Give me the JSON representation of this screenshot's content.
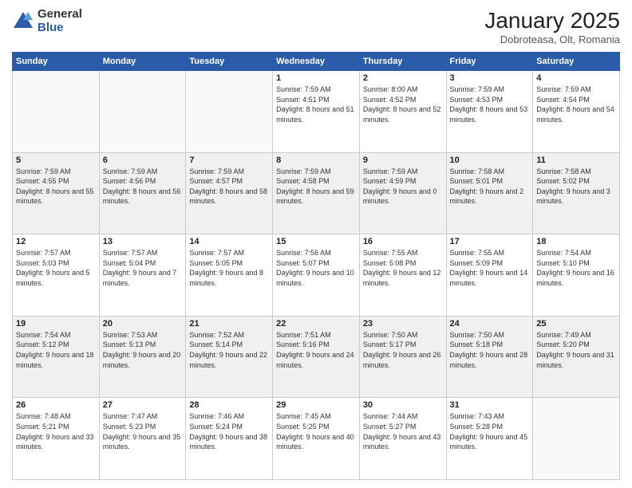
{
  "logo": {
    "general": "General",
    "blue": "Blue"
  },
  "header": {
    "month": "January 2025",
    "location": "Dobroteasa, Olt, Romania"
  },
  "weekdays": [
    "Sunday",
    "Monday",
    "Tuesday",
    "Wednesday",
    "Thursday",
    "Friday",
    "Saturday"
  ],
  "weeks": [
    [
      {
        "day": "",
        "info": ""
      },
      {
        "day": "",
        "info": ""
      },
      {
        "day": "",
        "info": ""
      },
      {
        "day": "1",
        "info": "Sunrise: 7:59 AM\nSunset: 4:51 PM\nDaylight: 8 hours and 51 minutes."
      },
      {
        "day": "2",
        "info": "Sunrise: 8:00 AM\nSunset: 4:52 PM\nDaylight: 8 hours and 52 minutes."
      },
      {
        "day": "3",
        "info": "Sunrise: 7:59 AM\nSunset: 4:53 PM\nDaylight: 8 hours and 53 minutes."
      },
      {
        "day": "4",
        "info": "Sunrise: 7:59 AM\nSunset: 4:54 PM\nDaylight: 8 hours and 54 minutes."
      }
    ],
    [
      {
        "day": "5",
        "info": "Sunrise: 7:59 AM\nSunset: 4:55 PM\nDaylight: 8 hours and 55 minutes."
      },
      {
        "day": "6",
        "info": "Sunrise: 7:59 AM\nSunset: 4:56 PM\nDaylight: 8 hours and 56 minutes."
      },
      {
        "day": "7",
        "info": "Sunrise: 7:59 AM\nSunset: 4:57 PM\nDaylight: 8 hours and 58 minutes."
      },
      {
        "day": "8",
        "info": "Sunrise: 7:59 AM\nSunset: 4:58 PM\nDaylight: 8 hours and 59 minutes."
      },
      {
        "day": "9",
        "info": "Sunrise: 7:59 AM\nSunset: 4:59 PM\nDaylight: 9 hours and 0 minutes."
      },
      {
        "day": "10",
        "info": "Sunrise: 7:58 AM\nSunset: 5:01 PM\nDaylight: 9 hours and 2 minutes."
      },
      {
        "day": "11",
        "info": "Sunrise: 7:58 AM\nSunset: 5:02 PM\nDaylight: 9 hours and 3 minutes."
      }
    ],
    [
      {
        "day": "12",
        "info": "Sunrise: 7:57 AM\nSunset: 5:03 PM\nDaylight: 9 hours and 5 minutes."
      },
      {
        "day": "13",
        "info": "Sunrise: 7:57 AM\nSunset: 5:04 PM\nDaylight: 9 hours and 7 minutes."
      },
      {
        "day": "14",
        "info": "Sunrise: 7:57 AM\nSunset: 5:05 PM\nDaylight: 9 hours and 8 minutes."
      },
      {
        "day": "15",
        "info": "Sunrise: 7:56 AM\nSunset: 5:07 PM\nDaylight: 9 hours and 10 minutes."
      },
      {
        "day": "16",
        "info": "Sunrise: 7:55 AM\nSunset: 5:08 PM\nDaylight: 9 hours and 12 minutes."
      },
      {
        "day": "17",
        "info": "Sunrise: 7:55 AM\nSunset: 5:09 PM\nDaylight: 9 hours and 14 minutes."
      },
      {
        "day": "18",
        "info": "Sunrise: 7:54 AM\nSunset: 5:10 PM\nDaylight: 9 hours and 16 minutes."
      }
    ],
    [
      {
        "day": "19",
        "info": "Sunrise: 7:54 AM\nSunset: 5:12 PM\nDaylight: 9 hours and 18 minutes."
      },
      {
        "day": "20",
        "info": "Sunrise: 7:53 AM\nSunset: 5:13 PM\nDaylight: 9 hours and 20 minutes."
      },
      {
        "day": "21",
        "info": "Sunrise: 7:52 AM\nSunset: 5:14 PM\nDaylight: 9 hours and 22 minutes."
      },
      {
        "day": "22",
        "info": "Sunrise: 7:51 AM\nSunset: 5:16 PM\nDaylight: 9 hours and 24 minutes."
      },
      {
        "day": "23",
        "info": "Sunrise: 7:50 AM\nSunset: 5:17 PM\nDaylight: 9 hours and 26 minutes."
      },
      {
        "day": "24",
        "info": "Sunrise: 7:50 AM\nSunset: 5:18 PM\nDaylight: 9 hours and 28 minutes."
      },
      {
        "day": "25",
        "info": "Sunrise: 7:49 AM\nSunset: 5:20 PM\nDaylight: 9 hours and 31 minutes."
      }
    ],
    [
      {
        "day": "26",
        "info": "Sunrise: 7:48 AM\nSunset: 5:21 PM\nDaylight: 9 hours and 33 minutes."
      },
      {
        "day": "27",
        "info": "Sunrise: 7:47 AM\nSunset: 5:23 PM\nDaylight: 9 hours and 35 minutes."
      },
      {
        "day": "28",
        "info": "Sunrise: 7:46 AM\nSunset: 5:24 PM\nDaylight: 9 hours and 38 minutes."
      },
      {
        "day": "29",
        "info": "Sunrise: 7:45 AM\nSunset: 5:25 PM\nDaylight: 9 hours and 40 minutes."
      },
      {
        "day": "30",
        "info": "Sunrise: 7:44 AM\nSunset: 5:27 PM\nDaylight: 9 hours and 43 minutes."
      },
      {
        "day": "31",
        "info": "Sunrise: 7:43 AM\nSunset: 5:28 PM\nDaylight: 9 hours and 45 minutes."
      },
      {
        "day": "",
        "info": ""
      }
    ]
  ]
}
